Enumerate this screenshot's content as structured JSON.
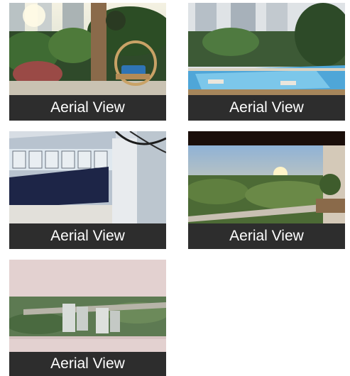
{
  "gallery": {
    "items": [
      {
        "caption": "Aerial View",
        "scene": "garden-lounge-image"
      },
      {
        "caption": "Aerial View",
        "scene": "pool-courtyard-image"
      },
      {
        "caption": "Aerial View",
        "scene": "building-facade-image"
      },
      {
        "caption": "Aerial View",
        "scene": "balcony-sunset-image"
      },
      {
        "caption": "Aerial View",
        "scene": "aerial-township-image"
      }
    ]
  }
}
